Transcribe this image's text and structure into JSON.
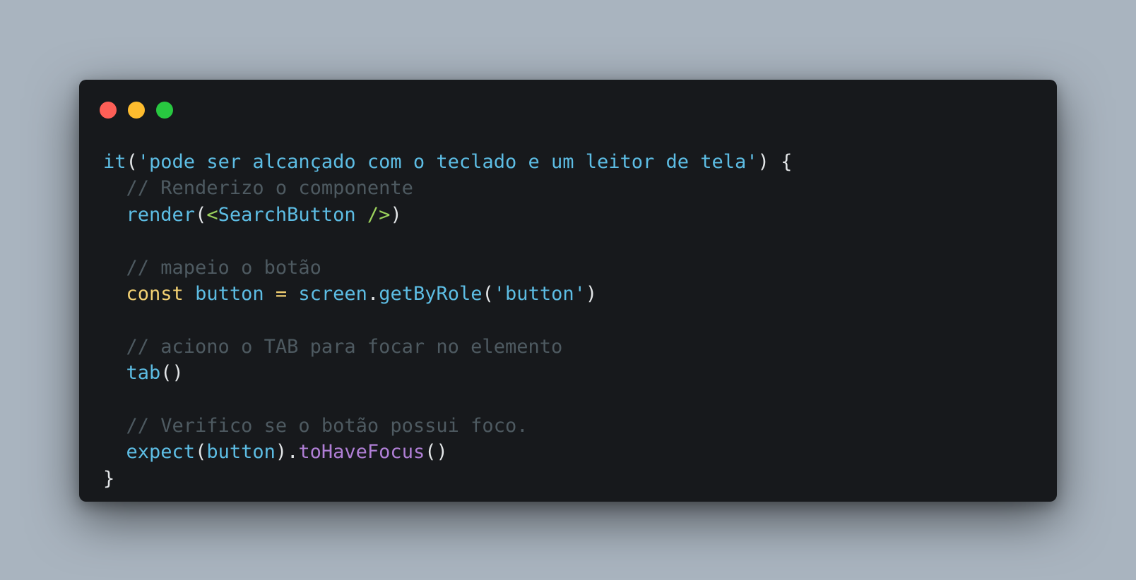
{
  "colors": {
    "page_background": "#a9b4bf",
    "window_background": "#17191c",
    "dot_close": "#fe5f57",
    "dot_minimize": "#febc2e",
    "dot_maximize": "#28c840",
    "plain": "#e3e6e8",
    "function": "#5dbde4",
    "string": "#5dbde4",
    "comment": "#4e5a61",
    "keyword": "#f3d173",
    "jsx_tag": "#9bd25c",
    "method": "#b07fd6"
  },
  "window_controls": [
    {
      "name": "close-dot",
      "color": "#fe5f57"
    },
    {
      "name": "minimize-dot",
      "color": "#febc2e"
    },
    {
      "name": "maximize-dot",
      "color": "#28c840"
    }
  ],
  "code": {
    "language": "javascript",
    "lines": [
      {
        "indent": "",
        "tokens": [
          {
            "text": "it",
            "type": "func"
          },
          {
            "text": "(",
            "type": "plain"
          },
          {
            "text": "'pode ser alcançado com o teclado e um leitor de tela'",
            "type": "string"
          },
          {
            "text": ") {",
            "type": "plain"
          }
        ]
      },
      {
        "indent": "  ",
        "tokens": [
          {
            "text": "// Renderizo o componente",
            "type": "comment"
          }
        ]
      },
      {
        "indent": "  ",
        "tokens": [
          {
            "text": "render",
            "type": "func"
          },
          {
            "text": "(",
            "type": "plain"
          },
          {
            "text": "<",
            "type": "jsx_tag"
          },
          {
            "text": "SearchButton",
            "type": "func"
          },
          {
            "text": " />",
            "type": "jsx_tag"
          },
          {
            "text": ")",
            "type": "plain"
          }
        ]
      },
      {
        "indent": "",
        "tokens": []
      },
      {
        "indent": "  ",
        "tokens": [
          {
            "text": "// mapeio o botão",
            "type": "comment"
          }
        ]
      },
      {
        "indent": "  ",
        "tokens": [
          {
            "text": "const",
            "type": "keyword"
          },
          {
            "text": " ",
            "type": "plain"
          },
          {
            "text": "button",
            "type": "func"
          },
          {
            "text": " ",
            "type": "plain"
          },
          {
            "text": "=",
            "type": "keyword"
          },
          {
            "text": " ",
            "type": "plain"
          },
          {
            "text": "screen",
            "type": "func"
          },
          {
            "text": ".",
            "type": "plain"
          },
          {
            "text": "getByRole",
            "type": "func"
          },
          {
            "text": "(",
            "type": "plain"
          },
          {
            "text": "'button'",
            "type": "string"
          },
          {
            "text": ")",
            "type": "plain"
          }
        ]
      },
      {
        "indent": "",
        "tokens": []
      },
      {
        "indent": "  ",
        "tokens": [
          {
            "text": "// aciono o TAB para focar no elemento",
            "type": "comment"
          }
        ]
      },
      {
        "indent": "  ",
        "tokens": [
          {
            "text": "tab",
            "type": "func"
          },
          {
            "text": "()",
            "type": "plain"
          }
        ]
      },
      {
        "indent": "",
        "tokens": []
      },
      {
        "indent": "  ",
        "tokens": [
          {
            "text": "// Verifico se o botão possui foco.",
            "type": "comment"
          }
        ]
      },
      {
        "indent": "  ",
        "tokens": [
          {
            "text": "expect",
            "type": "func"
          },
          {
            "text": "(",
            "type": "plain"
          },
          {
            "text": "button",
            "type": "func"
          },
          {
            "text": ").",
            "type": "plain"
          },
          {
            "text": "toHaveFocus",
            "type": "method"
          },
          {
            "text": "()",
            "type": "plain"
          }
        ]
      },
      {
        "indent": "",
        "tokens": [
          {
            "text": "}",
            "type": "plain"
          }
        ]
      }
    ]
  }
}
